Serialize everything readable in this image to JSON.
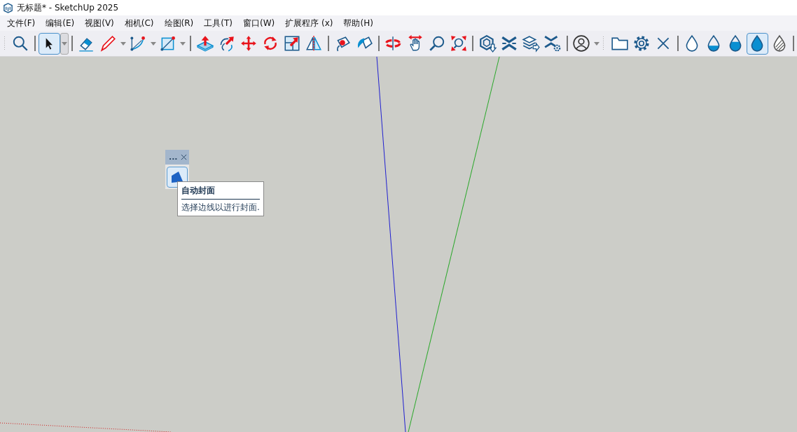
{
  "window": {
    "title": "无标题* - SketchUp 2025"
  },
  "menu": [
    {
      "label": "文件(F)"
    },
    {
      "label": "编辑(E)"
    },
    {
      "label": "视图(V)"
    },
    {
      "label": "相机(C)"
    },
    {
      "label": "绘图(R)"
    },
    {
      "label": "工具(T)"
    },
    {
      "label": "窗口(W)"
    },
    {
      "label": "扩展程序 (x)"
    },
    {
      "label": "帮助(H)"
    }
  ],
  "toolbars": [
    {
      "groups": [
        {
          "tools": [
            {
              "selected": false,
              "has_menu": false
            }
          ]
        },
        {
          "tools": [
            {
              "selected": true,
              "has_menu": true
            }
          ]
        },
        {
          "tools": [
            {
              "selected": false,
              "has_menu": false
            },
            {
              "selected": false,
              "has_menu": true
            },
            {
              "selected": false,
              "has_menu": true
            },
            {
              "selected": false,
              "has_menu": true
            }
          ]
        },
        {
          "tools": [
            {
              "selected": false,
              "has_menu": false
            },
            {
              "selected": false,
              "has_menu": false
            },
            {
              "selected": false,
              "has_menu": false
            },
            {
              "selected": false,
              "has_menu": false
            },
            {
              "selected": false,
              "has_menu": false
            },
            {
              "selected": false,
              "has_menu": false
            }
          ]
        },
        {
          "tools": [
            {
              "selected": false,
              "has_menu": false
            },
            {
              "selected": false,
              "has_menu": false
            }
          ]
        },
        {
          "tools": [
            {
              "selected": false,
              "has_menu": false
            },
            {
              "selected": false,
              "has_menu": false
            },
            {
              "selected": false,
              "has_menu": false
            },
            {
              "selected": false,
              "has_menu": false
            }
          ]
        },
        {
          "tools": [
            {
              "selected": false,
              "has_menu": false
            },
            {
              "selected": false,
              "has_menu": false
            },
            {
              "selected": false,
              "has_menu": false
            },
            {
              "selected": false,
              "has_menu": false
            }
          ]
        },
        {
          "tools": [
            {
              "selected": false,
              "has_menu": true
            }
          ]
        }
      ]
    },
    {
      "groups": [
        {
          "tools": [
            {
              "selected": false,
              "has_menu": false
            },
            {
              "selected": false,
              "has_menu": false
            },
            {
              "selected": false,
              "has_menu": false
            }
          ]
        },
        {
          "tools": [
            {
              "selected": false,
              "has_menu": false
            },
            {
              "selected": false,
              "has_menu": false
            },
            {
              "selected": false,
              "has_menu": false
            },
            {
              "selected": true,
              "has_menu": false
            },
            {
              "selected": false,
              "has_menu": false
            }
          ]
        }
      ]
    }
  ],
  "floating_toolbar": {
    "title": "...",
    "tools": [
      {
        "selected": true
      }
    ]
  },
  "tooltip": {
    "title": "自动封面",
    "description": "选择边线以进行封面."
  }
}
